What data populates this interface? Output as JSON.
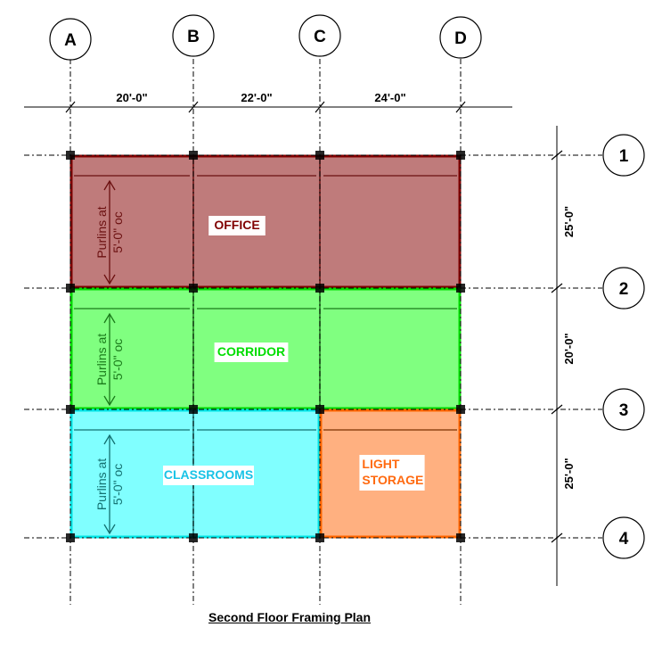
{
  "title": "Second Floor Framing Plan",
  "grid": {
    "columns": [
      {
        "label": "A"
      },
      {
        "label": "B"
      },
      {
        "label": "C"
      },
      {
        "label": "D"
      }
    ],
    "rows": [
      {
        "label": "1"
      },
      {
        "label": "2"
      },
      {
        "label": "3"
      },
      {
        "label": "4"
      }
    ],
    "column_spacings": [
      "20'-0\"",
      "22'-0\"",
      "24'-0\""
    ],
    "row_spacings": [
      "25'-0\"",
      "20'-0\"",
      "25'-0\""
    ]
  },
  "rooms": [
    {
      "name": "office",
      "label": "OFFICE",
      "fill": "#bf7b7b",
      "stroke": "#800000",
      "text_color": "#800000",
      "span_cols": [
        "A",
        "D"
      ],
      "span_rows": [
        "1",
        "2"
      ],
      "purlin_note": [
        "Purlins at",
        "5'-0\" oc"
      ],
      "purlin_color": "#6b1010"
    },
    {
      "name": "corridor",
      "label": "CORRIDOR",
      "fill": "#80ff80",
      "stroke": "#00dd00",
      "text_color": "#00dd00",
      "span_cols": [
        "A",
        "D"
      ],
      "span_rows": [
        "2",
        "3"
      ],
      "purlin_note": [
        "Purlins at",
        "5'-0\" oc"
      ],
      "purlin_color": "#1a7a1a"
    },
    {
      "name": "classrooms",
      "label": "CLASSROOMS",
      "fill": "#80ffff",
      "stroke": "#00e5e5",
      "text_color": "#19c3e6",
      "span_cols": [
        "A",
        "C"
      ],
      "span_rows": [
        "3",
        "4"
      ],
      "purlin_note": [
        "Purlins at",
        "5'-0\" oc"
      ],
      "purlin_color": "#137070"
    },
    {
      "name": "light-storage",
      "label": [
        "LIGHT",
        "STORAGE"
      ],
      "fill": "#ffb080",
      "stroke": "#ff6600",
      "text_color": "#ff6a10",
      "span_cols": [
        "C",
        "D"
      ],
      "span_rows": [
        "3",
        "4"
      ],
      "purlin_note": null,
      "purlin_color": "#7a3000"
    }
  ],
  "colors": {
    "gridline": "#000000",
    "column_marker": "#000000"
  }
}
